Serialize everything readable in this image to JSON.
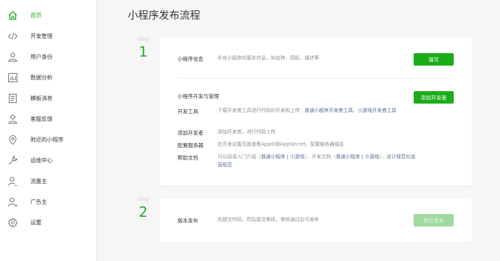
{
  "sidebar": {
    "items": [
      {
        "label": "首页",
        "icon": "home-icon",
        "active": true
      },
      {
        "label": "开发管理",
        "icon": "code-icon"
      },
      {
        "label": "用户身份",
        "icon": "user-icon"
      },
      {
        "label": "数据分析",
        "icon": "chart-icon"
      },
      {
        "label": "模板消息",
        "icon": "document-icon"
      },
      {
        "label": "客服反馈",
        "icon": "headset-icon"
      },
      {
        "label": "附近的小程序",
        "icon": "location-pin-icon"
      },
      {
        "label": "运维中心",
        "icon": "wrench-icon"
      },
      {
        "label": "流量主",
        "icon": "user-traffic-icon"
      },
      {
        "label": "广告主",
        "icon": "user-ad-icon"
      },
      {
        "label": "设置",
        "icon": "gear-icon"
      }
    ]
  },
  "main": {
    "title": "小程序发布流程",
    "step1": {
      "step_word": "step",
      "step_number": "1",
      "info": {
        "title": "小程序信息",
        "desc": "补充小程序的基本信息，如名称、图标、描述等",
        "button": "填写"
      },
      "dev": {
        "title": "小程序开发与管理",
        "button": "添加开发者",
        "rows": {
          "tools": {
            "label": "开发工具",
            "desc_prefix": "下载开发者工具进行代码的开发和上传：",
            "link1": "普通小程序开发者工具",
            "sep": "、",
            "link2": "小游戏开发者工具"
          },
          "add_dev": {
            "label": "添加开发者",
            "desc": "添加开发者，进行代码上传"
          },
          "server": {
            "label": "配置服务器",
            "desc": "在开发设置页面查看AppID和AppSecret，配置服务器域名"
          },
          "docs": {
            "label": "帮助文档",
            "desc_1": "可以阅读入门介绍（",
            "link_1": "普通小程序",
            "pipe_1": " | ",
            "link_2": "小游戏",
            "desc_2": "）、开发文档（",
            "link_3": "普通小程序",
            "pipe_2": " | ",
            "link_4": "小游戏",
            "desc_3": "）、",
            "link_5": "设计规范",
            "desc_4": "和",
            "link_6": "运营规范"
          }
        }
      }
    },
    "step2": {
      "step_word": "step",
      "step_number": "2",
      "title": "版本发布",
      "desc": "先提交代码，然后提交审核，审核通过后可发布",
      "button": "前往发布"
    }
  },
  "colors": {
    "accent": "#1aad19",
    "link": "#576b95",
    "disabled_button": "#9ed99d"
  }
}
